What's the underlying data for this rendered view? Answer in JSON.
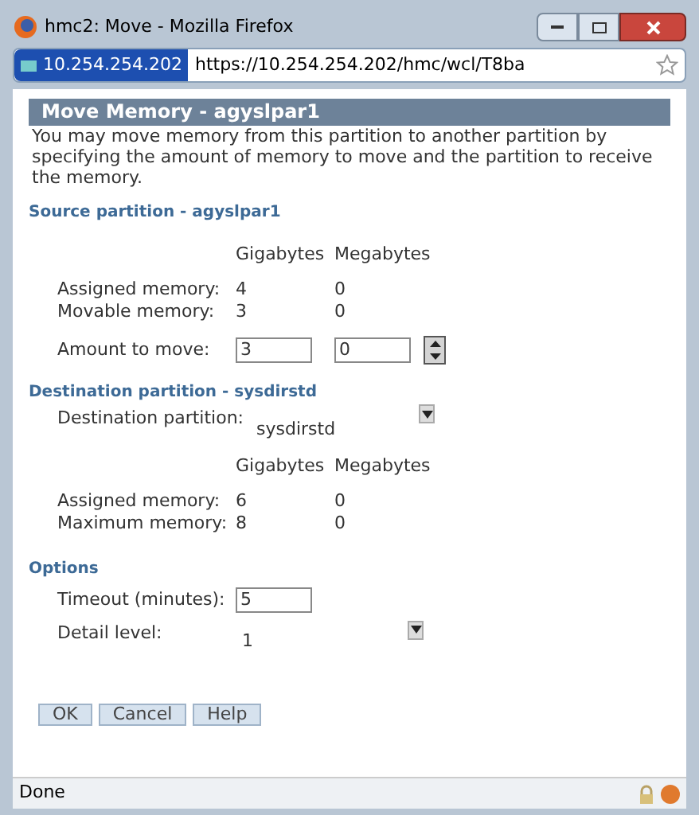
{
  "window": {
    "title": "hmc2: Move - Mozilla Firefox"
  },
  "address_bar": {
    "site_badge": "10.254.254.202",
    "url": "https://10.254.254.202/hmc/wcl/T8ba"
  },
  "dialog": {
    "title": "Move Memory - agyslpar1",
    "description": "You may move memory from this partition to another partition by specifying the amount of memory to move and the partition to receive the memory."
  },
  "source": {
    "heading": "Source partition - agyslpar1",
    "column_headers": [
      "Gigabytes",
      "Megabytes"
    ],
    "rows": [
      {
        "label": "Assigned memory:",
        "gigabytes": "4",
        "megabytes": "0"
      },
      {
        "label": "Movable memory:",
        "gigabytes": "3",
        "megabytes": "0"
      }
    ],
    "amount": {
      "label": "Amount to move:",
      "gigabytes": "3",
      "megabytes": "0"
    }
  },
  "destination": {
    "heading": "Destination partition - sysdirstd",
    "partition_label": "Destination partition:",
    "partition_value": "sysdirstd",
    "column_headers": [
      "Gigabytes",
      "Megabytes"
    ],
    "rows": [
      {
        "label": "Assigned memory:",
        "gigabytes": "6",
        "megabytes": "0"
      },
      {
        "label": "Maximum memory:",
        "gigabytes": "8",
        "megabytes": "0"
      }
    ]
  },
  "options": {
    "heading": "Options",
    "timeout_label": "Timeout (minutes):",
    "timeout_value": "5",
    "detail_label": "Detail level:",
    "detail_value": "1"
  },
  "buttons": [
    "OK",
    "Cancel",
    "Help"
  ],
  "status_bar": {
    "text": "Done"
  }
}
